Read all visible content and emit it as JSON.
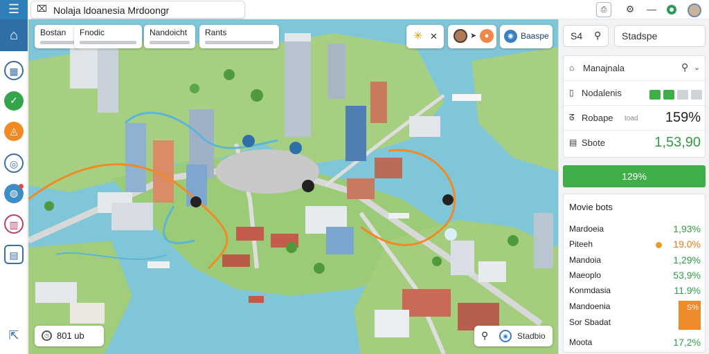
{
  "topbar": {
    "title": "Nolaja ldoanesia Mrdoongr",
    "menu_icon": "hamburger-icon",
    "title_icon": "close-icon"
  },
  "sidebar": {
    "items": [
      {
        "name": "home-icon",
        "glyph": "⌂"
      },
      {
        "name": "grid-icon",
        "glyph": "▦"
      },
      {
        "name": "leaf-icon",
        "glyph": "✓"
      },
      {
        "name": "flame-icon",
        "glyph": "◬"
      },
      {
        "name": "target-icon",
        "glyph": "◎"
      },
      {
        "name": "globe-icon",
        "glyph": "◍"
      },
      {
        "name": "gallery-icon",
        "glyph": "▥"
      },
      {
        "name": "note-icon",
        "glyph": "▤"
      },
      {
        "name": "share-icon",
        "glyph": "⇱"
      }
    ]
  },
  "map": {
    "cards": [
      {
        "title": "Bostan"
      },
      {
        "title": "Fnodic"
      },
      {
        "title": "Nandoicht"
      },
      {
        "title": "Rants"
      }
    ],
    "pill_right_label": "Baaspe",
    "bottom_left_label": "801 ub",
    "bottom_right_label": "Stadbio"
  },
  "panel": {
    "search_a_label": "S4",
    "search_b_placeholder": "Stadspe",
    "header_label": "Manajnala",
    "rating_label": "Nodalenis",
    "rate_label": "Robape",
    "rate_sublabel": "toad",
    "rate_value": "159%",
    "score_label": "Sbote",
    "score_value": "1,53,90",
    "bar_label": "129%",
    "list_title": "Movie bots",
    "list": [
      {
        "name": "Mardoeia",
        "value": "1,93%"
      },
      {
        "name": "Piteeh",
        "value": "19.0%"
      },
      {
        "name": "Mandoia",
        "value": "1,29%"
      },
      {
        "name": "Maeoplo",
        "value": "53,9%"
      },
      {
        "name": "Konmdasia",
        "value": "11.9%"
      },
      {
        "name": "Mandoenia",
        "value": ""
      },
      {
        "name": "Sor Sbadat",
        "value": ""
      },
      {
        "name": "Moota",
        "value": "17,2%"
      }
    ],
    "orange_box_label": "S%",
    "colors": {
      "green": "#3fae48",
      "orange": "#ef8a2c",
      "accent": "#2f6fa8"
    }
  }
}
